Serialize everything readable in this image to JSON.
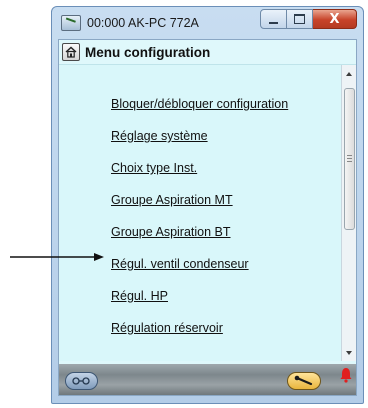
{
  "window": {
    "title": "00:000 AK-PC 772A",
    "controls": {
      "minimize": "minimize",
      "maximize": "maximize",
      "close": "X"
    }
  },
  "header": {
    "title": "Menu configuration",
    "home_icon": "home-icon"
  },
  "menu": {
    "items": [
      {
        "label": "Bloquer/débloquer configuration"
      },
      {
        "label": "Réglage système"
      },
      {
        "label": "Choix type Inst."
      },
      {
        "label": "Groupe Aspiration MT"
      },
      {
        "label": "Groupe Aspiration BT"
      },
      {
        "label": "Régul. ventil condenseur"
      },
      {
        "label": "Régul. HP"
      },
      {
        "label": "Régulation réservoir"
      }
    ]
  },
  "scrollbar": {
    "position_fraction": 0.0
  },
  "status_bar": {
    "icons": [
      "connection-icon",
      "service-tool-icon",
      "alarm-bell-icon"
    ],
    "alarm_color": "#e02020"
  },
  "annotation": {
    "pointer": "arrow pointing to Régul. ventil condenseur"
  },
  "colors": {
    "client_background": "#d9f7fa",
    "close_button": "#c7432a"
  }
}
